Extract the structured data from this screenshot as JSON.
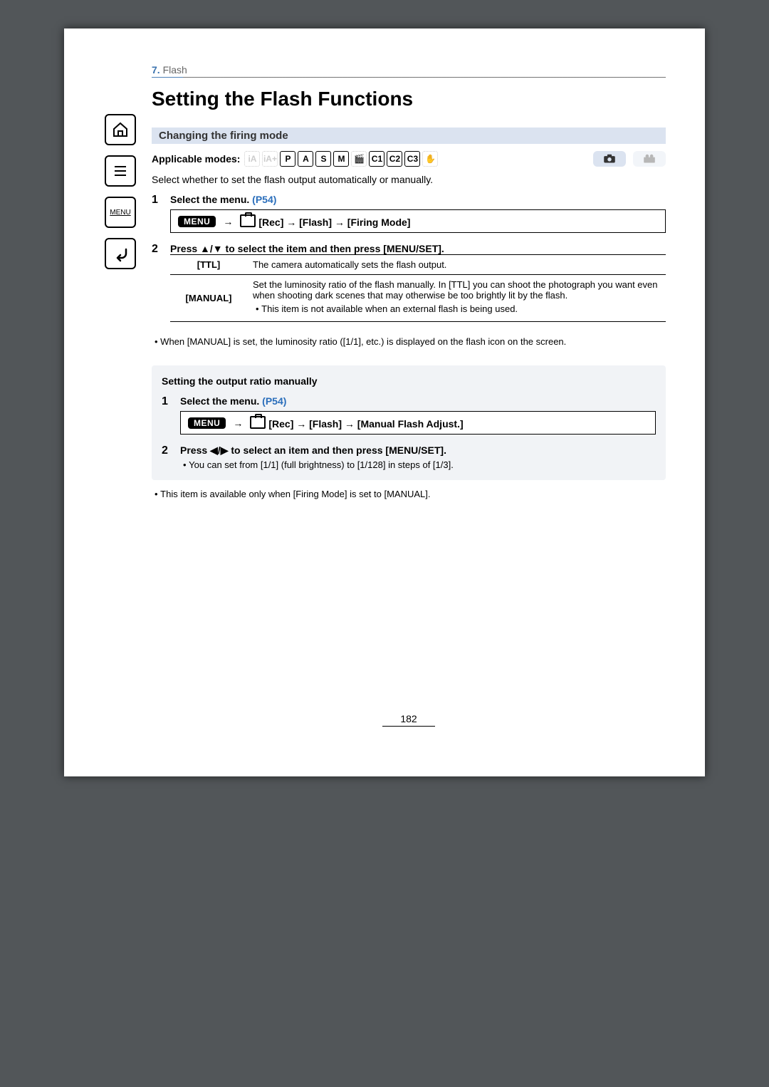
{
  "breadcrumb": {
    "number": "7.",
    "label": "Flash"
  },
  "title": "Setting the Flash Functions",
  "sidebar": {
    "home_label": "",
    "toc_label": "",
    "menu_label": "MENU",
    "back_label": ""
  },
  "section1": {
    "heading": "Changing the firing mode",
    "applicable_label": "Applicable modes:",
    "modes": [
      "iA",
      "iA+",
      "P",
      "A",
      "S",
      "M",
      "🎬",
      "C1",
      "C2",
      "C3",
      "✋"
    ],
    "modes_active": [
      false,
      false,
      true,
      true,
      true,
      true,
      false,
      true,
      true,
      true,
      false
    ],
    "intro": "Select whether to set the flash output automatically or manually.",
    "step1_num": "1",
    "step1_prefix": "Select the menu. ",
    "step1_link": "(P54)",
    "menu_badge": "MENU",
    "menu_path": "[Rec] → [Flash] → [Firing Mode]",
    "step2_num": "2",
    "step2_text": "Press ▲/▼ to select the item and then press [MENU/SET].",
    "options": [
      {
        "name": "[TTL]",
        "desc": "The camera automatically sets the flash output."
      },
      {
        "name": "[MANUAL]",
        "desc": "Set the luminosity ratio of the flash manually. In [TTL] you can shoot the photograph you want even when shooting dark scenes that may otherwise be too brightly lit by the flash.",
        "note": "This item is not available when an external flash is being used."
      }
    ],
    "footnote": "When [MANUAL] is set, the luminosity ratio ([1/1], etc.) is displayed on the flash icon on the screen."
  },
  "section2": {
    "heading": "Setting the output ratio manually",
    "step1_num": "1",
    "step1_prefix": "Select the menu. ",
    "step1_link": "(P54)",
    "menu_badge": "MENU",
    "menu_path": "[Rec] → [Flash] → [Manual Flash Adjust.]",
    "step2_num": "2",
    "step2_text": "Press ◀/▶ to select an item and then press [MENU/SET].",
    "step2_note": "You can set from [1/1] (full brightness) to [1/128] in steps of [1/3].",
    "footnote": "This item is available only when [Firing Mode] is set to [MANUAL]."
  },
  "page_number": "182"
}
